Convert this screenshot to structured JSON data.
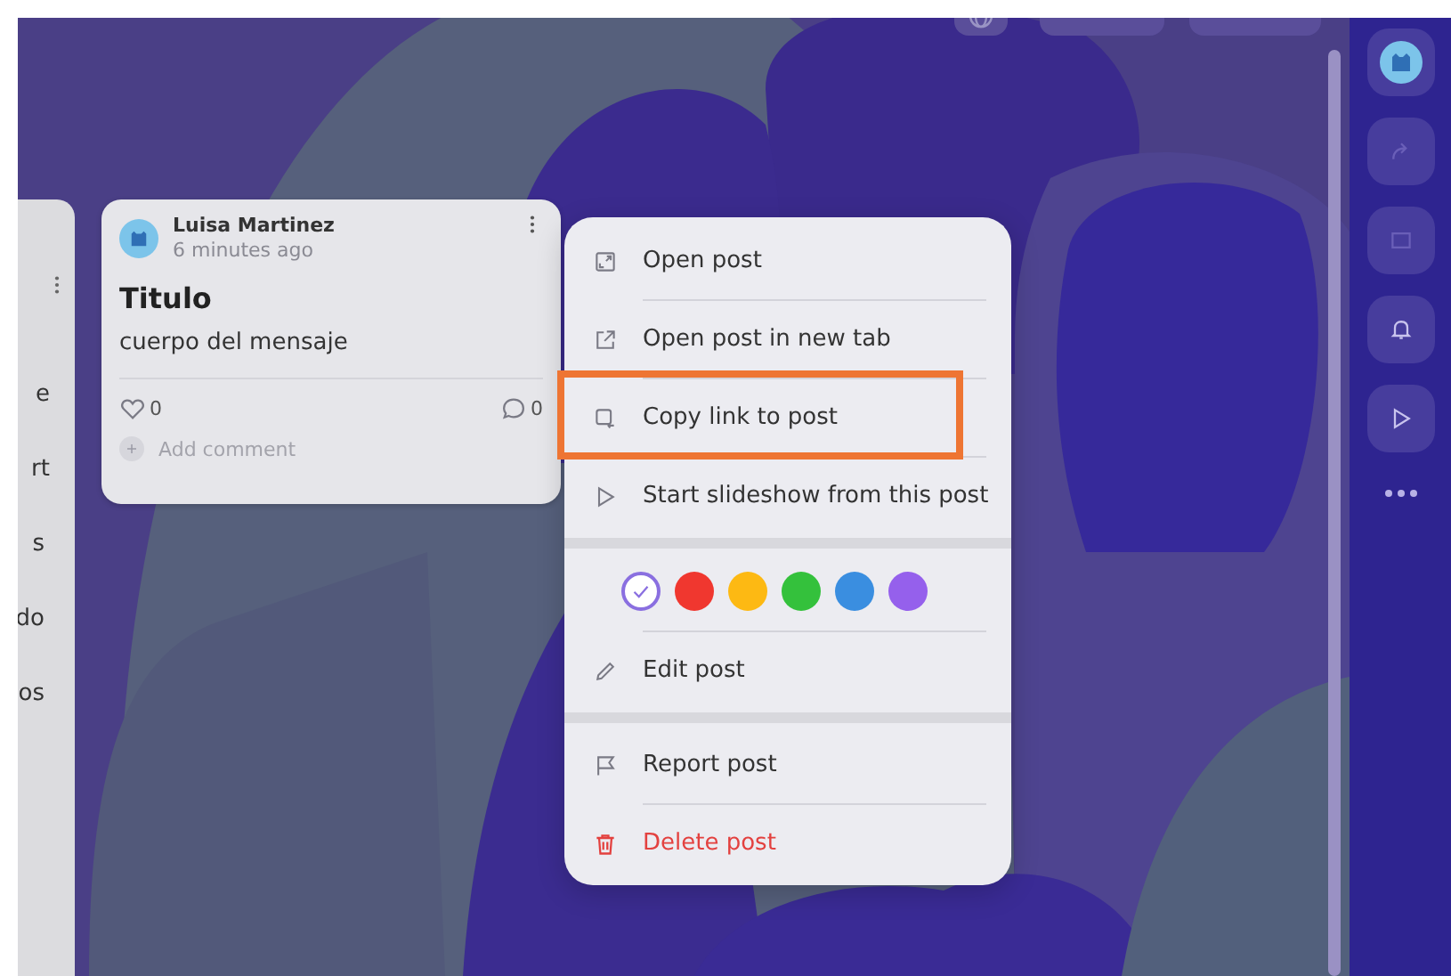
{
  "board": {
    "left_column": {
      "texts": [
        "e",
        "rt",
        "s",
        "do",
        "os"
      ]
    },
    "post": {
      "author": "Luisa Martinez",
      "time": "6 minutes ago",
      "title": "Titulo",
      "body": "cuerpo del mensaje",
      "likes": "0",
      "comments": "0",
      "comment_placeholder": "Add comment"
    }
  },
  "context_menu": {
    "sections": [
      {
        "items": [
          {
            "kind": "open",
            "label": "Open post",
            "highlighted": false
          },
          {
            "kind": "new-tab",
            "label": "Open post in new tab",
            "highlighted": false
          },
          {
            "kind": "copy-link",
            "label": "Copy link to post",
            "highlighted": true
          },
          {
            "kind": "slideshow",
            "label": "Start slideshow from this post",
            "highlighted": false
          }
        ]
      },
      {
        "items": [
          {
            "kind": "colors",
            "swatches": [
              {
                "color": "#ffffff",
                "selected": true
              },
              {
                "color": "#f0372f",
                "selected": false
              },
              {
                "color": "#fdb913",
                "selected": false
              },
              {
                "color": "#34c13c",
                "selected": false
              },
              {
                "color": "#3a8ee0",
                "selected": false
              },
              {
                "color": "#9560ec",
                "selected": false
              }
            ]
          },
          {
            "kind": "edit",
            "label": "Edit post",
            "highlighted": false
          }
        ]
      },
      {
        "items": [
          {
            "kind": "report",
            "label": "Report post",
            "highlighted": false
          },
          {
            "kind": "delete",
            "label": "Delete post",
            "highlighted": false
          }
        ]
      }
    ]
  }
}
